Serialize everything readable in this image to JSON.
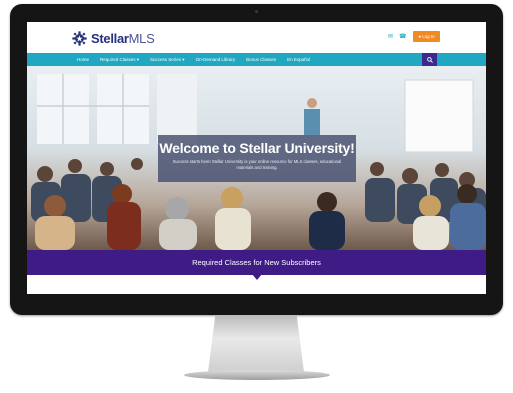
{
  "brand": {
    "name_main": "Stellar",
    "name_suffix": "MLS",
    "logo_icon": "gear-star-logo-icon",
    "primary_color": "#26327a"
  },
  "header": {
    "icons": [
      "envelope-icon",
      "phone-icon"
    ],
    "login_label": "Log In",
    "login_color": "#f08b24"
  },
  "nav": {
    "color": "#20a7c1",
    "items": [
      {
        "label": "Home"
      },
      {
        "label": "Required Classes ▾"
      },
      {
        "label": "Success Series ▾"
      },
      {
        "label": "On-Demand Library"
      },
      {
        "label": "Bonus Classes"
      },
      {
        "label": "En Español"
      }
    ],
    "search_icon": "search-icon"
  },
  "hero": {
    "title": "Welcome to Stellar University!",
    "subtitle": "Success starts here! Stellar University is your online resource for MLS classes, educational materials and training."
  },
  "band": {
    "text": "Required Classes for New Subscribers",
    "color": "#3f1b86"
  }
}
